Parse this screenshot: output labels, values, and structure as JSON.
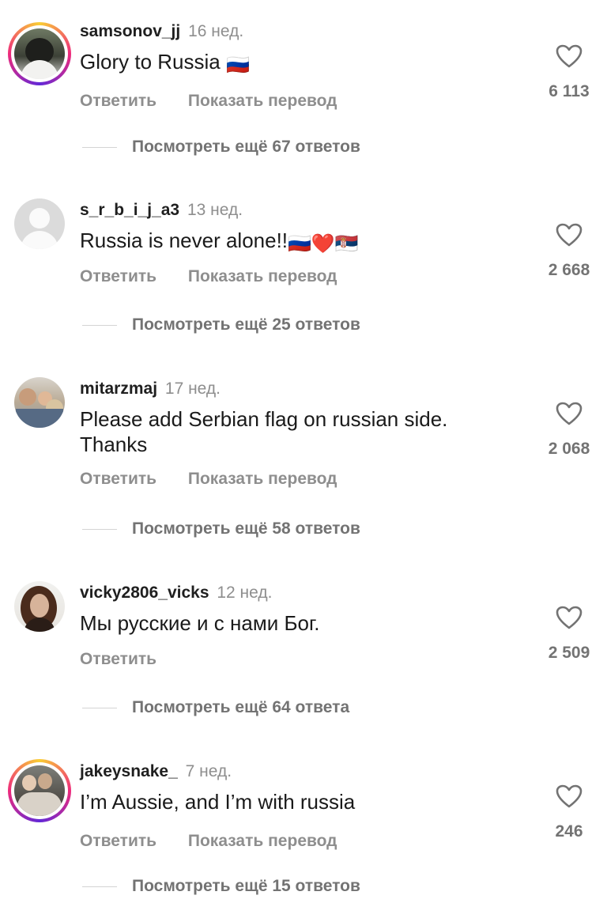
{
  "labels": {
    "reply": "Ответить",
    "show_translation": "Показать перевод"
  },
  "comments": [
    {
      "username": "samsonov_jj",
      "time": "16 нед.",
      "text": "Glory to Russia",
      "emoji": "🇷🇺",
      "likes": "6 113",
      "replies": "Посмотреть ещё 67 ответов"
    },
    {
      "username": "s_r_b_i_j_a3",
      "time": "13 нед.",
      "text": "Russia is never alone!!",
      "emoji": "🇷🇺❤️🇷🇸",
      "likes": "2 668",
      "replies": "Посмотреть ещё 25 ответов"
    },
    {
      "username": "mitarzmaj",
      "time": "17 нед.",
      "text": "Please add Serbian flag on russian side. Thanks",
      "likes": "2 068",
      "replies": "Посмотреть ещё 58 ответов"
    },
    {
      "username": "vicky2806_vicks",
      "time": "12 нед.",
      "text": "Мы русские и с нами Бог.",
      "likes": "2 509",
      "replies": "Посмотреть ещё 64 ответа"
    },
    {
      "username": "jakeysnake_",
      "time": "7 нед.",
      "text": "I’m Aussie, and I’m with russia",
      "likes": "246",
      "replies": "Посмотреть ещё 15 ответов"
    }
  ],
  "icons": {
    "like": "heart-outline-icon",
    "default_avatar": "default-avatar-icon"
  }
}
